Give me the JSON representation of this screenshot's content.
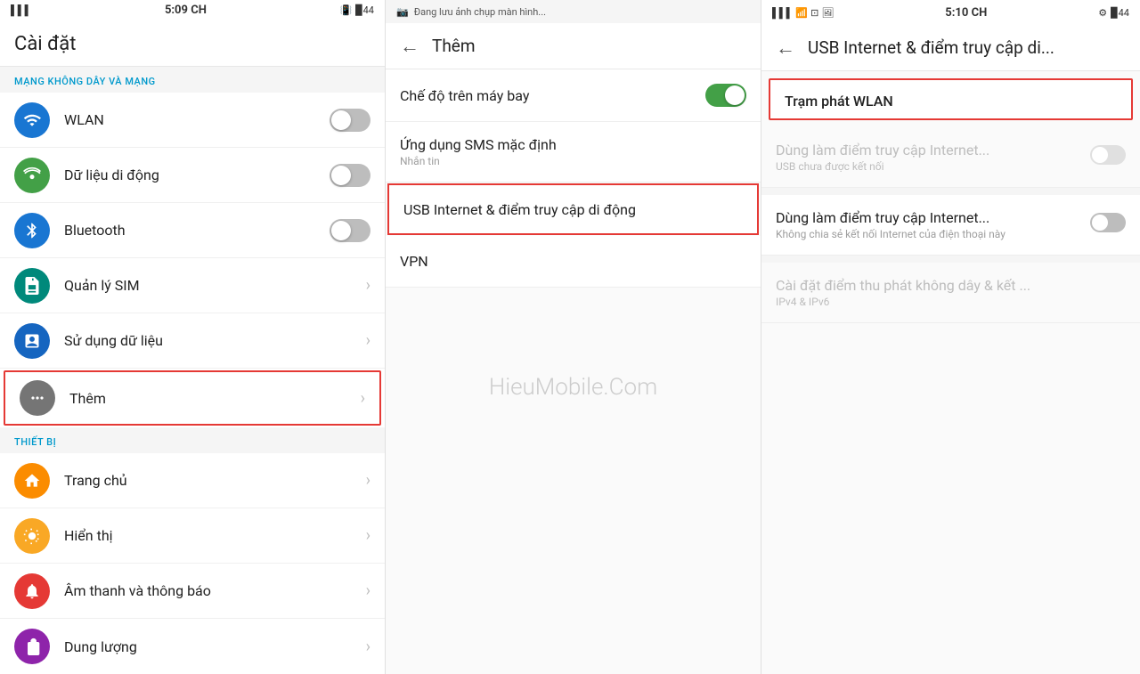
{
  "panels": {
    "left": {
      "status_bar": {
        "signal": "▌▌▌",
        "time": "5:09 CH",
        "battery": "44",
        "battery_icon": "🔋"
      },
      "title": "Cài đặt",
      "sections": [
        {
          "label": "MẠNG KHÔNG DÂY VÀ MẠNG",
          "items": [
            {
              "icon": "wifi",
              "icon_color": "blue",
              "label": "WLAN",
              "has_toggle": true,
              "toggle_on": false,
              "has_chevron": false
            },
            {
              "icon": "mobile",
              "icon_color": "green",
              "label": "Dữ liệu di động",
              "has_toggle": true,
              "toggle_on": false,
              "has_chevron": false
            },
            {
              "icon": "bluetooth",
              "icon_color": "blue",
              "label": "Bluetooth",
              "has_toggle": true,
              "toggle_on": false,
              "has_chevron": false
            },
            {
              "icon": "sim",
              "icon_color": "teal",
              "label": "Quản lý SIM",
              "has_toggle": false,
              "has_chevron": true
            },
            {
              "icon": "data",
              "icon_color": "darkblue",
              "label": "Sử dụng dữ liệu",
              "has_toggle": false,
              "has_chevron": true
            },
            {
              "icon": "more",
              "icon_color": "gray",
              "label": "Thêm",
              "has_toggle": false,
              "has_chevron": true,
              "highlighted": true
            }
          ]
        },
        {
          "label": "THIẾT BỊ",
          "items": [
            {
              "icon": "home",
              "icon_color": "orange",
              "label": "Trang chủ",
              "has_toggle": false,
              "has_chevron": true
            },
            {
              "icon": "display",
              "icon_color": "yellow",
              "label": "Hiển thị",
              "has_toggle": false,
              "has_chevron": true
            },
            {
              "icon": "bell",
              "icon_color": "red",
              "label": "Âm thanh và thông báo",
              "has_toggle": false,
              "has_chevron": true
            },
            {
              "icon": "storage",
              "icon_color": "purple",
              "label": "Dung lượng",
              "has_toggle": false,
              "has_chevron": true
            }
          ]
        }
      ]
    },
    "middle": {
      "status_bar": {
        "notif": "Đang lưu ảnh chụp màn hình...",
        "time": ""
      },
      "title": "Thêm",
      "items": [
        {
          "label": "Chế độ trên máy bay",
          "has_toggle": true,
          "toggle_on": true,
          "highlighted": false
        },
        {
          "label": "Ứng dụng SMS mặc định",
          "sub": "Nhắn tin",
          "has_toggle": false,
          "highlighted": false
        },
        {
          "label": "USB Internet & điểm truy cập di động",
          "has_toggle": false,
          "highlighted": true
        },
        {
          "label": "VPN",
          "has_toggle": false,
          "highlighted": false
        }
      ],
      "watermark": "HieuMobile.Com"
    },
    "right": {
      "status_bar": {
        "signal": "▌▌▌",
        "wifi": "(●)",
        "time": "5:10 CH",
        "battery": "44"
      },
      "title": "USB Internet & điểm truy cập di...",
      "sections": [
        {
          "type": "highlighted_header",
          "title": "Trạm phát WLAN"
        },
        {
          "type": "dimmed_toggle",
          "title": "Dùng làm điểm truy cập Internet...",
          "sub": "USB chưa được kết nối",
          "toggle_on": false,
          "dimmed": true
        },
        {
          "type": "normal_toggle",
          "title": "Dùng làm điểm truy cập Internet...",
          "sub": "Không chia sẻ kết nối Internet của điện thoại này",
          "toggle_on": false,
          "dimmed": false
        },
        {
          "type": "dimmed_info",
          "title": "Cài đặt điểm thu phát không dây & kết ...",
          "sub": "IPv4 & IPv6",
          "dimmed": true
        }
      ]
    }
  }
}
